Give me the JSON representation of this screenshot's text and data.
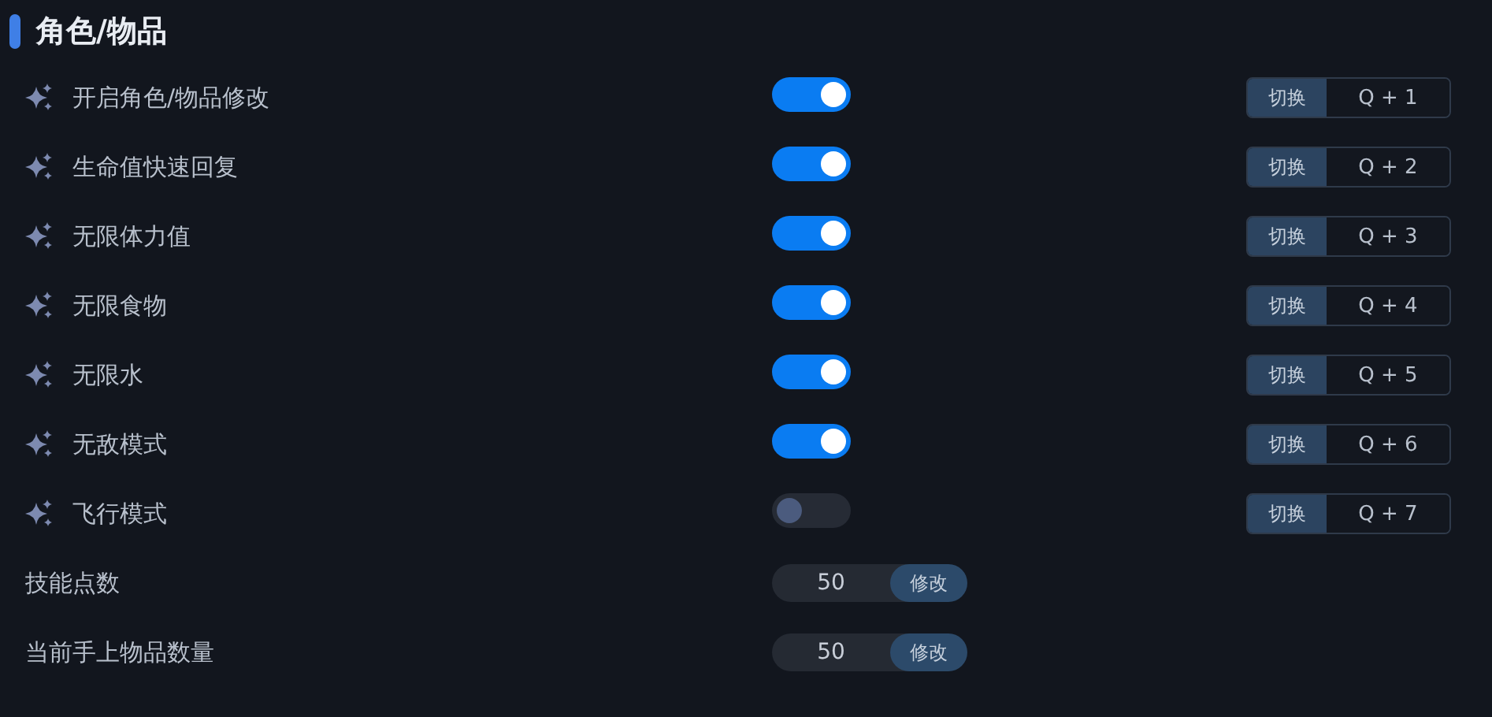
{
  "section": {
    "title": "角色/物品"
  },
  "rows": [
    {
      "kind": "toggle",
      "label": "开启角色/物品修改",
      "on": true,
      "action": "切换",
      "hotkey": "Q + 1"
    },
    {
      "kind": "toggle",
      "label": "生命值快速回复",
      "on": true,
      "action": "切换",
      "hotkey": "Q + 2"
    },
    {
      "kind": "toggle",
      "label": "无限体力值",
      "on": true,
      "action": "切换",
      "hotkey": "Q + 3"
    },
    {
      "kind": "toggle",
      "label": "无限食物",
      "on": true,
      "action": "切换",
      "hotkey": "Q + 4"
    },
    {
      "kind": "toggle",
      "label": "无限水",
      "on": true,
      "action": "切换",
      "hotkey": "Q + 5"
    },
    {
      "kind": "toggle",
      "label": "无敌模式",
      "on": true,
      "action": "切换",
      "hotkey": "Q + 6"
    },
    {
      "kind": "toggle",
      "label": "飞行模式",
      "on": false,
      "action": "切换",
      "hotkey": "Q + 7"
    },
    {
      "kind": "number",
      "label": "技能点数",
      "value": "50",
      "button": "修改"
    },
    {
      "kind": "number",
      "label": "当前手上物品数量",
      "value": "50",
      "button": "修改"
    }
  ]
}
